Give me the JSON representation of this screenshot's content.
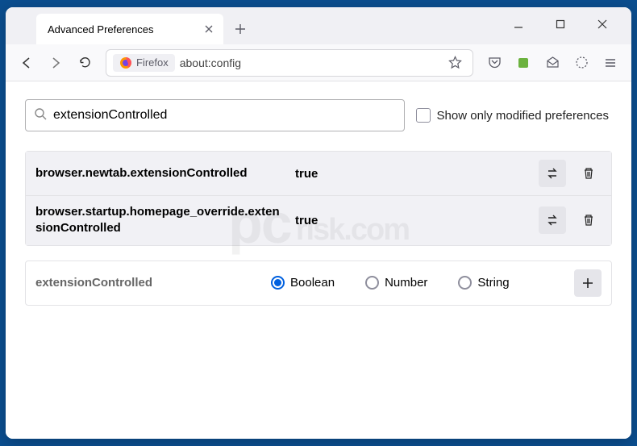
{
  "tab": {
    "title": "Advanced Preferences"
  },
  "urlbar": {
    "identity": "Firefox",
    "url": "about:config"
  },
  "content": {
    "search_value": "extensionControlled",
    "filter_label": "Show only modified preferences",
    "prefs": [
      {
        "name": "browser.newtab.extensionControlled",
        "value": "true"
      },
      {
        "name": "browser.startup.homepage_override.extensionControlled",
        "value": "true"
      }
    ],
    "new_pref_name": "extensionControlled",
    "type_options": [
      "Boolean",
      "Number",
      "String"
    ]
  },
  "watermark": {
    "main": "pc",
    "sub": "risk.com"
  }
}
